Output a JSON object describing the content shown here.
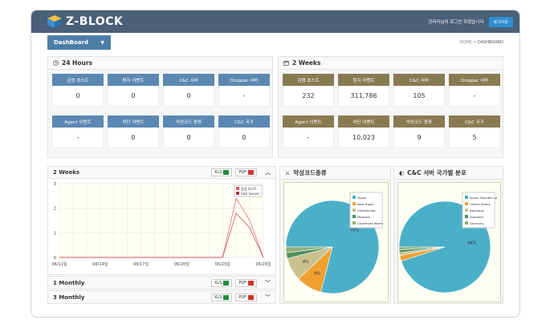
{
  "app": {
    "title": "Z-BLOCK",
    "greeting": "관리자님이 로그인 하셨습니다",
    "logout": "로그아웃"
  },
  "nav": {
    "dashboard": "DashBoard",
    "breadcrumb_home": "HOME",
    "breadcrumb_sep": ">",
    "breadcrumb_current": "DASHBOARD"
  },
  "panel24": {
    "title": "24 Hours",
    "cards": [
      {
        "label": "감염 호스트",
        "value": "0"
      },
      {
        "label": "탐지 이벤트",
        "value": "0"
      },
      {
        "label": "C&C 서버",
        "value": "0"
      },
      {
        "label": "Dropper 서버",
        "value": "-"
      },
      {
        "label": "Agent 이벤트",
        "value": "-"
      },
      {
        "label": "차단 이벤트",
        "value": "0"
      },
      {
        "label": "악성코드 종류",
        "value": "0"
      },
      {
        "label": "C&C 국가",
        "value": "0"
      }
    ]
  },
  "panel2w": {
    "title": "2 Weeks",
    "cards": [
      {
        "label": "감염 호스트",
        "value": "232"
      },
      {
        "label": "탐지 이벤트",
        "value": "311,786"
      },
      {
        "label": "C&C 서버",
        "value": "105"
      },
      {
        "label": "Dropper 서버",
        "value": "-"
      },
      {
        "label": "Agent 이벤트",
        "value": "-"
      },
      {
        "label": "차단 이벤트",
        "value": "10,023"
      },
      {
        "label": "악성코드 종류",
        "value": "9"
      },
      {
        "label": "C&C 국가",
        "value": "5"
      }
    ]
  },
  "trend": {
    "title": "2 Weeks",
    "xls": "XLS",
    "pdf": "PDF"
  },
  "monthly1": {
    "title": "1 Monthly",
    "xls": "XLS",
    "pdf": "PDF"
  },
  "monthly3": {
    "title": "3 Monthly",
    "xls": "XLS",
    "pdf": "PDF"
  },
  "malware": {
    "title": "악성코드종류"
  },
  "ccserver": {
    "title": "C&C 서버 국가별 분포"
  },
  "chart_data": [
    {
      "type": "line",
      "x": [
        "06/11일",
        "06/12일",
        "06/13일",
        "06/14일",
        "06/15일",
        "06/16일",
        "06/17일",
        "06/18일",
        "06/19일",
        "06/20일",
        "06/21일",
        "06/22일",
        "06/23일",
        "06/24일",
        "06/25일",
        "06/26일"
      ],
      "xticks": [
        "06/11일",
        "06/14일",
        "06/17일",
        "06/20일",
        "06/23일",
        "06/26일"
      ],
      "series": [
        {
          "name": "감염 호스트",
          "color": "#e84b6a",
          "values": [
            0,
            0,
            0,
            0,
            0,
            0,
            0,
            0,
            0,
            0,
            0,
            0,
            0,
            2.4,
            1.5,
            0
          ]
        },
        {
          "name": "C&C Server",
          "color": "#b0303a",
          "values": [
            0,
            0,
            0,
            0,
            0,
            0,
            0,
            0,
            0,
            0,
            0,
            0,
            0,
            1.8,
            1.2,
            0
          ]
        }
      ],
      "ylim": [
        0,
        3
      ],
      "yticks": [
        0,
        1,
        2,
        3
      ],
      "legend": "top-right"
    },
    {
      "type": "pie",
      "labels": [
        "Trojan",
        "New Trojan",
        "UnDetected",
        "Malware",
        "Confirmed Worm"
      ],
      "values": [
        79,
        9,
        8,
        2,
        2
      ],
      "value_labels": [
        "79%",
        "9%",
        "8%",
        "",
        ""
      ],
      "colors": [
        "#4ab0c8",
        "#f0a030",
        "#c9c18e",
        "#4f8f5e",
        "#8fb07a"
      ],
      "legend": "top-right"
    },
    {
      "type": "pie",
      "labels": [
        "Korea, Republic of",
        "United States",
        "Bahamas",
        "Australia",
        "Germany"
      ],
      "values": [
        95,
        2,
        1,
        1,
        1
      ],
      "value_labels": [
        "96%",
        "",
        "",
        "",
        ""
      ],
      "colors": [
        "#4ab0c8",
        "#f0a030",
        "#c9c18e",
        "#4f8f5e",
        "#8fb07a"
      ],
      "legend": "top-right"
    }
  ]
}
